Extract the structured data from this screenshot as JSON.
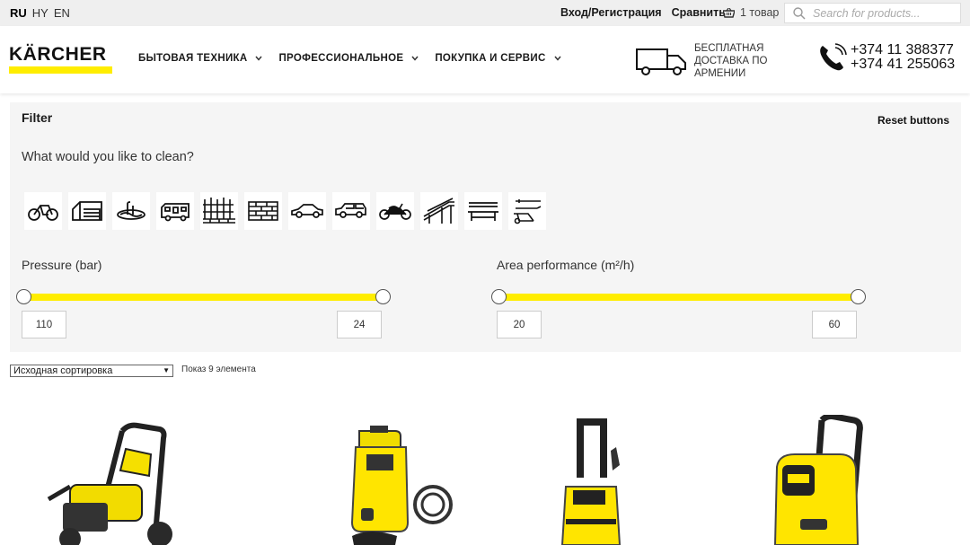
{
  "topbar": {
    "langs": [
      "RU",
      "HY",
      "EN"
    ],
    "login": "Вход/Регистрация",
    "compare": "Сравнить",
    "cart": "1 товар",
    "search_placeholder": "Search for products..."
  },
  "header": {
    "logo": "KÄRCHER",
    "nav": [
      "БЫТОВАЯ ТЕХНИКА",
      "ПРОФЕССИОНАЛЬНОЕ",
      "ПОКУПКА И СЕРВИС"
    ],
    "delivery": "БЕСПЛАТНАЯ ДОСТАВКА ПО АРМЕНИИ",
    "phone1": "+374 11 388377",
    "phone2": "+374 41 255063"
  },
  "filter": {
    "title": "Filter",
    "reset": "Reset buttons",
    "question": "What would you like to clean?",
    "icons": [
      "bicycle-icon",
      "garage-icon",
      "pool-icon",
      "camper-icon",
      "fence-icon",
      "brick-wall-icon",
      "car-icon",
      "suv-icon",
      "motorcycle-icon",
      "stairs-icon",
      "bench-icon",
      "garden-tools-icon"
    ],
    "pressure": {
      "label": "Pressure (bar)",
      "min": "110",
      "max": "24"
    },
    "area": {
      "label": "Area performance (m²/h)",
      "min": "20",
      "max": "60"
    }
  },
  "sorting": {
    "selected": "Исходная сортировка",
    "count": "Показ 9 элемента"
  },
  "colors": {
    "brand_yellow": "#ffed00",
    "panel": "#f5f5f5"
  }
}
